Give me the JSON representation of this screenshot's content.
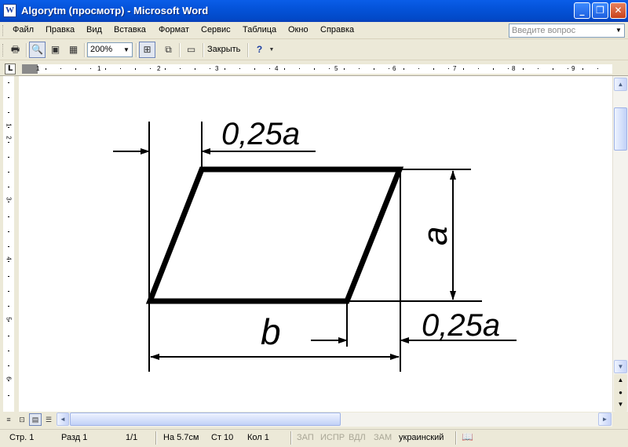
{
  "window": {
    "title": "Algorytm (просмотр) - Microsoft Word",
    "app_icon": "W",
    "minimize_icon": "_",
    "restore_icon": "❐",
    "close_icon": "✕"
  },
  "menu": {
    "items": [
      "Файл",
      "Правка",
      "Вид",
      "Вставка",
      "Формат",
      "Сервис",
      "Таблица",
      "Окно",
      "Справка"
    ],
    "help_placeholder": "Введите вопрос",
    "dropdown_icon": "▼"
  },
  "toolbar": {
    "zoom_value": "200%",
    "close_label": "Закрыть",
    "print_icon": "🖶",
    "magnifier_icon": "🔍",
    "one_page_icon": "▣",
    "multi_page_icon": "▦",
    "view_ruler_icon": "⊞",
    "shrink_icon": "⧉",
    "fullscreen_icon": "▭",
    "help_icon": "?"
  },
  "ruler": {
    "tab_selector": "L",
    "numbers": [
      "1",
      "1",
      "2",
      "3",
      "4",
      "5",
      "6",
      "7",
      "8",
      "9"
    ],
    "vertical_numbers": [
      "1",
      "2",
      "3",
      "4",
      "5",
      "6"
    ]
  },
  "drawing": {
    "label_top_offset": "0,25a",
    "label_side": "a",
    "label_bottom": "b",
    "label_bottom_offset": "0,25a"
  },
  "scroll": {
    "up_icon": "▲",
    "down_icon": "▼",
    "left_icon": "◄",
    "right_icon": "►",
    "prev_icon": "▲",
    "select_icon": "●",
    "next_icon": "▼"
  },
  "views": {
    "normal_icon": "≡",
    "web_icon": "⊡",
    "print_icon": "▤",
    "outline_icon": "☰"
  },
  "status": {
    "page": "Стр. 1",
    "section": "Разд 1",
    "pages": "1/1",
    "at": "На 5.7см",
    "line": "Ст 10",
    "col": "Кол 1",
    "rec": "ЗАП",
    "trk": "ИСПР",
    "ext": "ВДЛ",
    "ovr": "ЗАМ",
    "language": "украинский",
    "spell_icon": "📖"
  }
}
